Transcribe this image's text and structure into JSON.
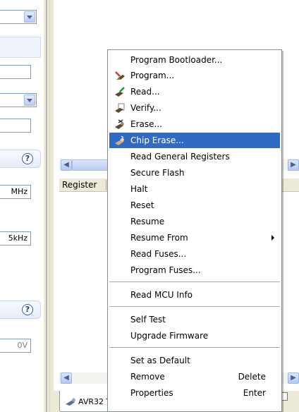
{
  "left_panel": {
    "freq_1": "MHz",
    "freq_2": "5kHz",
    "voltage": "0V",
    "help_1": "?",
    "help_2": "?"
  },
  "content": {
    "column_header": "Register",
    "tab_label": "AVR32 T"
  },
  "context_menu": {
    "items": [
      {
        "label": "Program Bootloader...",
        "icon": null
      },
      {
        "label": "Program...",
        "icon": "program-icon"
      },
      {
        "label": "Read...",
        "icon": "read-icon"
      },
      {
        "label": "Verify...",
        "icon": "verify-icon"
      },
      {
        "label": "Erase...",
        "icon": "erase-icon"
      },
      {
        "label": "Chip Erase...",
        "icon": "chip-erase-icon",
        "selected": true
      },
      {
        "label": "Read General Registers"
      },
      {
        "label": "Secure Flash"
      },
      {
        "label": "Halt"
      },
      {
        "label": "Reset"
      },
      {
        "label": "Resume"
      },
      {
        "label": "Resume From",
        "submenu": true
      },
      {
        "label": "Read Fuses..."
      },
      {
        "label": "Program Fuses..."
      },
      {
        "label": "Read MCU Info"
      },
      {
        "label": "Self Test"
      },
      {
        "label": "Upgrade Firmware"
      },
      {
        "label": "Set as Default"
      },
      {
        "label": "Remove",
        "shortcut": "Delete"
      },
      {
        "label": "Properties",
        "shortcut": "Enter"
      }
    ]
  },
  "colors": {
    "selection": "#316ac5",
    "menu_background": "#ffffff"
  }
}
